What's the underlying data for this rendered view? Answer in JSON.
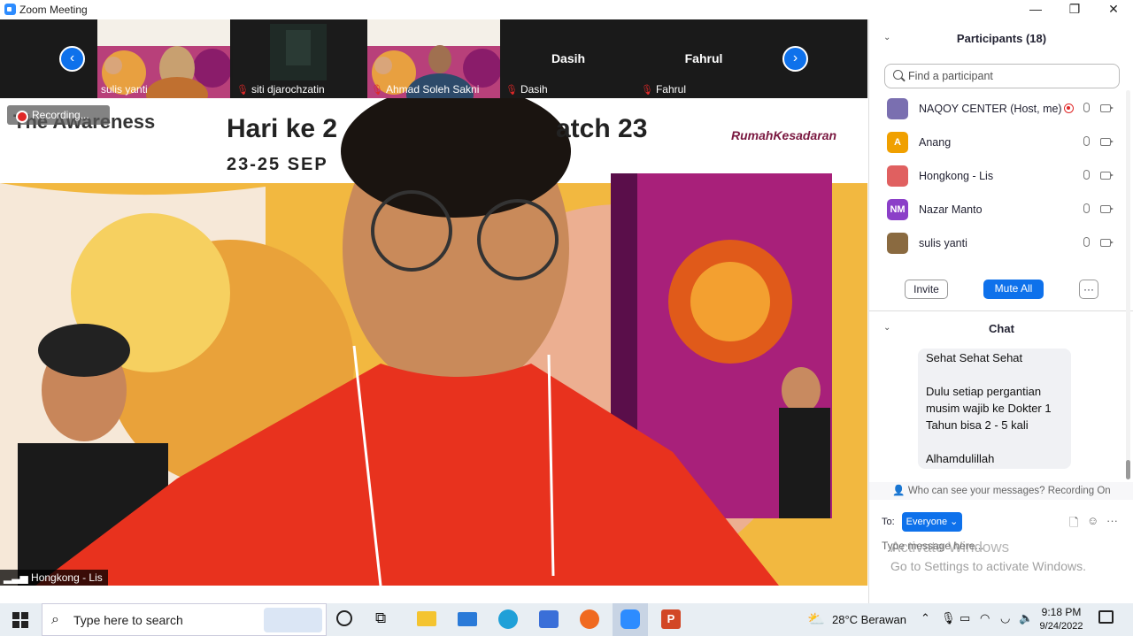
{
  "window": {
    "title": "Zoom Meeting"
  },
  "strip": {
    "thumbs": [
      {
        "name": "sulis yanti",
        "muted": false
      },
      {
        "name": "siti djarochzatin",
        "muted": true
      },
      {
        "name": "Ahmad Soleh Sakni",
        "muted": true
      },
      {
        "name": "Dasih",
        "muted": true,
        "big": "Dasih"
      },
      {
        "name": "Fahrul",
        "muted": true,
        "big": "Fahrul"
      }
    ]
  },
  "main": {
    "recording": "Recording...",
    "speaker": "Hongkong - Lis",
    "banner_title": "Hari ke 2",
    "banner_title_right": "atch 23",
    "banner_date": "23-25 SEP",
    "logo_left": "The  Awareness",
    "logo_right": "RumahKesadaran"
  },
  "participants": {
    "header": "Participants (18)",
    "search_placeholder": "Find a participant",
    "list": [
      {
        "name": "NAQOY CENTER (Host, me)",
        "initials": "",
        "color": "#7a6fb0"
      },
      {
        "name": "Anang",
        "initials": "A",
        "color": "#f0a000"
      },
      {
        "name": "Hongkong - Lis",
        "initials": "",
        "color": "#e06060"
      },
      {
        "name": "Nazar Manto",
        "initials": "NM",
        "color": "#8b3fc8"
      },
      {
        "name": "sulis yanti",
        "initials": "",
        "color": "#8a6a40"
      }
    ],
    "invite": "Invite",
    "mute_all": "Mute All",
    "more": "···"
  },
  "chat": {
    "header": "Chat",
    "message_lines": [
      "Sehat Sehat Sehat",
      "",
      "Dulu setiap pergantian",
      "musim wajib ke Dokter 1",
      "Tahun bisa 2 - 5 kali",
      "",
      "Alhamdulillah"
    ],
    "who_can_see": "Who can see your messages? Recording On",
    "to_label": "To:",
    "to_value": "Everyone",
    "input_placeholder": "Type message here..."
  },
  "watermark": {
    "line1": "Activate Windows",
    "line2": "Go to Settings to activate Windows."
  },
  "taskbar": {
    "search": "Type here to search",
    "weather": "28°C  Berawan",
    "time": "9:18 PM",
    "date": "9/24/2022"
  }
}
